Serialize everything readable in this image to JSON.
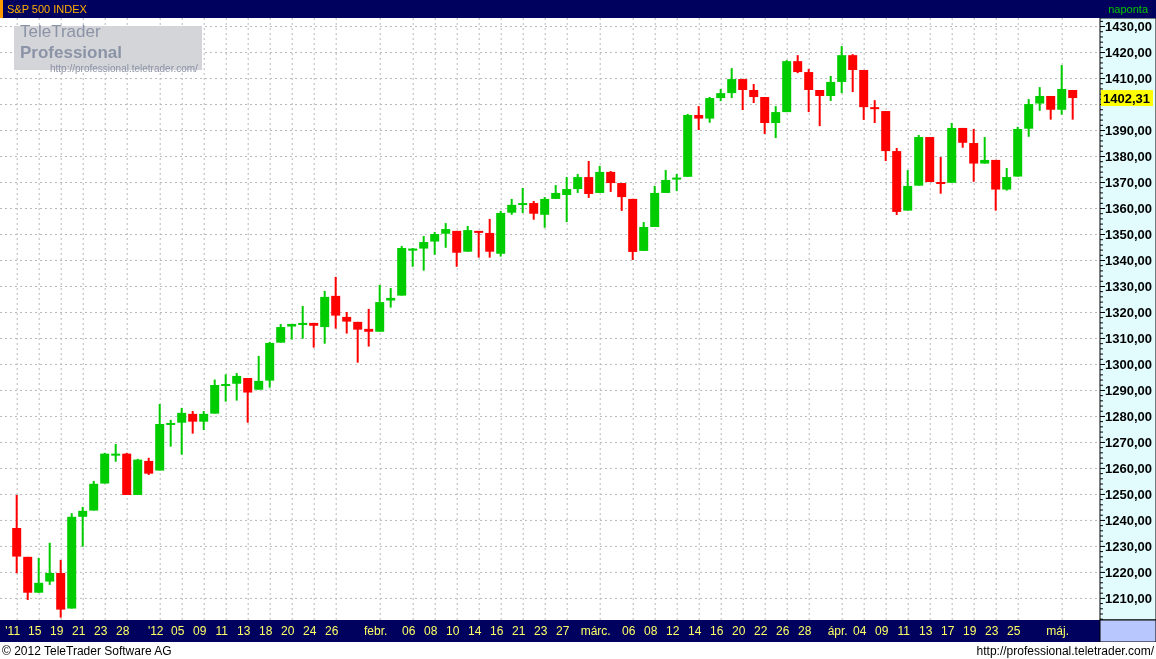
{
  "header": {
    "title": "S&P 500 INDEX",
    "interval": "naponta"
  },
  "logo": {
    "name": "TeleTrader **Professional**",
    "url": "http://professional.teletrader.com/"
  },
  "chart": {
    "current_price": "1402,31",
    "chart_data": {
      "type": "candlestick",
      "grid": true,
      "ylim": [
        1201.5,
        1433.1
      ],
      "categories": [
        "'11",
        null,
        "15",
        null,
        "19",
        null,
        "21",
        null,
        "23",
        null,
        "28",
        null,
        null,
        "'12",
        null,
        "05",
        null,
        "09",
        null,
        "11",
        null,
        "13",
        null,
        "18",
        null,
        "20",
        null,
        "24",
        null,
        "26",
        null,
        null,
        null,
        "febr.",
        null,
        null,
        "06",
        null,
        "08",
        null,
        "10",
        null,
        "14",
        null,
        "16",
        null,
        "21",
        null,
        "23",
        null,
        "27",
        null,
        null,
        "márc.",
        null,
        null,
        "06",
        null,
        "08",
        null,
        "12",
        null,
        "14",
        null,
        "16",
        null,
        "20",
        null,
        "22",
        null,
        "26",
        null,
        "28",
        null,
        null,
        "ápr.",
        null,
        "04",
        null,
        "09",
        null,
        "11",
        null,
        "13",
        null,
        "17",
        null,
        "19",
        null,
        "23",
        null,
        "25",
        null,
        null,
        null,
        "máj.",
        null
      ],
      "ohlc": [
        [
          1236.9,
          1249.6,
          1219.5,
          1225.9
        ],
        [
          1225.8,
          1225.8,
          1209.2,
          1212.0
        ],
        [
          1212.0,
          1225.4,
          1212.0,
          1215.8
        ],
        [
          1216.3,
          1231.2,
          1215.0,
          1219.6
        ],
        [
          1219.6,
          1224.6,
          1202.4,
          1205.5
        ],
        [
          1205.9,
          1242.6,
          1205.9,
          1241.2
        ],
        [
          1241.2,
          1245.0,
          1229.7,
          1243.5
        ],
        [
          1243.6,
          1255.0,
          1243.6,
          1253.9
        ],
        [
          1254.0,
          1265.8,
          1254.0,
          1265.5
        ],
        [
          1264.8,
          1269.2,
          1262.4,
          1265.5
        ],
        [
          1265.5,
          1265.8,
          1249.6,
          1249.6
        ],
        [
          1249.6,
          1263.5,
          1249.6,
          1263.2
        ],
        [
          1262.7,
          1263.9,
          1257.3,
          1257.8
        ],
        [
          1259.0,
          1284.6,
          1259.0,
          1276.9
        ],
        [
          1276.6,
          1278.5,
          1268.2,
          1277.3
        ],
        [
          1277.4,
          1283.1,
          1265.1,
          1281.2
        ],
        [
          1280.8,
          1281.9,
          1273.2,
          1277.8
        ],
        [
          1277.8,
          1281.9,
          1274.6,
          1280.8
        ],
        [
          1280.9,
          1294.0,
          1280.9,
          1291.9
        ],
        [
          1291.7,
          1296.0,
          1285.5,
          1292.3
        ],
        [
          1292.4,
          1296.5,
          1285.9,
          1295.4
        ],
        [
          1294.6,
          1294.6,
          1277.4,
          1289.0
        ],
        [
          1290.1,
          1303.1,
          1290.1,
          1293.5
        ],
        [
          1293.6,
          1308.5,
          1290.9,
          1308.1
        ],
        [
          1308.2,
          1315.4,
          1308.2,
          1314.2
        ],
        [
          1314.4,
          1315.4,
          1309.4,
          1315.4
        ],
        [
          1315.0,
          1322.3,
          1309.7,
          1315.8
        ],
        [
          1315.8,
          1315.8,
          1306.3,
          1314.7
        ],
        [
          1314.2,
          1328.1,
          1307.8,
          1325.8
        ],
        [
          1326.2,
          1333.5,
          1313.6,
          1318.6
        ],
        [
          1318.1,
          1320.0,
          1311.7,
          1316.3
        ],
        [
          1316.2,
          1316.2,
          1300.5,
          1313.2
        ],
        [
          1313.5,
          1321.2,
          1306.7,
          1312.4
        ],
        [
          1312.4,
          1330.4,
          1312.4,
          1323.8
        ],
        [
          1324.4,
          1329.2,
          1321.7,
          1325.4
        ],
        [
          1326.3,
          1345.4,
          1326.3,
          1344.6
        ],
        [
          1343.6,
          1344.6,
          1337.4,
          1344.4
        ],
        [
          1344.4,
          1349.2,
          1335.9,
          1346.9
        ],
        [
          1347.1,
          1350.8,
          1342.0,
          1350.0
        ],
        [
          1350.1,
          1354.2,
          1344.7,
          1351.9
        ],
        [
          1351.2,
          1351.2,
          1337.4,
          1342.8
        ],
        [
          1343.2,
          1353.1,
          1343.2,
          1351.5
        ],
        [
          1351.2,
          1351.2,
          1340.9,
          1350.5
        ],
        [
          1350.4,
          1355.8,
          1340.9,
          1343.2
        ],
        [
          1342.4,
          1358.9,
          1341.3,
          1358.1
        ],
        [
          1358.2,
          1363.5,
          1357.4,
          1361.2
        ],
        [
          1361.2,
          1367.7,
          1358.1,
          1361.9
        ],
        [
          1361.9,
          1362.7,
          1355.5,
          1357.8
        ],
        [
          1357.4,
          1364.2,
          1352.4,
          1363.5
        ],
        [
          1363.5,
          1368.8,
          1363.5,
          1365.8
        ],
        [
          1365.0,
          1371.9,
          1354.6,
          1367.3
        ],
        [
          1367.3,
          1373.1,
          1365.8,
          1371.9
        ],
        [
          1371.9,
          1378.1,
          1363.9,
          1365.4
        ],
        [
          1365.8,
          1376.2,
          1365.8,
          1373.9
        ],
        [
          1373.9,
          1374.2,
          1366.2,
          1369.6
        ],
        [
          1369.6,
          1369.6,
          1358.9,
          1364.2
        ],
        [
          1363.5,
          1363.5,
          1340.0,
          1343.1
        ],
        [
          1343.5,
          1354.6,
          1343.5,
          1352.7
        ],
        [
          1352.7,
          1368.5,
          1352.7,
          1365.8
        ],
        [
          1365.8,
          1374.6,
          1365.8,
          1370.8
        ],
        [
          1371.2,
          1373.1,
          1366.5,
          1371.7
        ],
        [
          1372.0,
          1396.2,
          1372.0,
          1395.8
        ],
        [
          1395.8,
          1399.2,
          1390.0,
          1394.4
        ],
        [
          1394.4,
          1402.7,
          1392.8,
          1402.3
        ],
        [
          1402.3,
          1405.8,
          1401.1,
          1404.2
        ],
        [
          1404.2,
          1413.8,
          1402.3,
          1409.6
        ],
        [
          1409.6,
          1409.6,
          1397.7,
          1405.4
        ],
        [
          1405.4,
          1407.7,
          1400.4,
          1402.7
        ],
        [
          1402.7,
          1402.7,
          1388.5,
          1392.7
        ],
        [
          1392.7,
          1399.2,
          1386.9,
          1396.9
        ],
        [
          1396.9,
          1416.9,
          1396.9,
          1416.5
        ],
        [
          1416.5,
          1418.8,
          1411.9,
          1412.3
        ],
        [
          1412.3,
          1413.5,
          1396.9,
          1405.4
        ],
        [
          1405.4,
          1405.4,
          1391.5,
          1403.1
        ],
        [
          1403.1,
          1410.8,
          1401.2,
          1408.5
        ],
        [
          1408.5,
          1422.3,
          1404.2,
          1418.8
        ],
        [
          1418.8,
          1419.2,
          1404.6,
          1413.1
        ],
        [
          1413.1,
          1413.1,
          1393.9,
          1398.8
        ],
        [
          1398.8,
          1401.5,
          1392.7,
          1398.1
        ],
        [
          1397.3,
          1397.3,
          1378.1,
          1381.9
        ],
        [
          1381.9,
          1383.1,
          1357.3,
          1358.5
        ],
        [
          1359.0,
          1374.6,
          1359.0,
          1368.5
        ],
        [
          1368.6,
          1388.1,
          1368.6,
          1387.3
        ],
        [
          1387.3,
          1387.3,
          1370.0,
          1370.0
        ],
        [
          1370.0,
          1379.6,
          1365.5,
          1369.4
        ],
        [
          1369.7,
          1392.7,
          1369.7,
          1390.8
        ],
        [
          1390.8,
          1390.8,
          1383.2,
          1385.1
        ],
        [
          1385.0,
          1390.4,
          1370.1,
          1377.1
        ],
        [
          1377.1,
          1387.3,
          1377.1,
          1378.5
        ],
        [
          1378.5,
          1378.5,
          1359.0,
          1367.1
        ],
        [
          1367.1,
          1375.4,
          1366.7,
          1371.9
        ],
        [
          1372.1,
          1391.2,
          1372.1,
          1390.4
        ],
        [
          1390.5,
          1401.9,
          1387.4,
          1400.0
        ],
        [
          1400.2,
          1406.5,
          1397.4,
          1403.1
        ],
        [
          1403.1,
          1403.1,
          1394.0,
          1397.8
        ],
        [
          1397.8,
          1415.0,
          1395.9,
          1405.8
        ],
        [
          1405.4,
          1405.4,
          1394.0,
          1402.3
        ]
      ],
      "yticks": [
        {
          "value": 1430,
          "label": "1430,00"
        },
        {
          "value": 1420,
          "label": "1420,00"
        },
        {
          "value": 1410,
          "label": "1410,00"
        },
        {
          "value": 1390,
          "label": "1390,00"
        },
        {
          "value": 1380,
          "label": "1380,00"
        },
        {
          "value": 1370,
          "label": "1370,00"
        },
        {
          "value": 1360,
          "label": "1360,00"
        },
        {
          "value": 1350,
          "label": "1350,00"
        },
        {
          "value": 1340,
          "label": "1340,00"
        },
        {
          "value": 1330,
          "label": "1330,00"
        },
        {
          "value": 1320,
          "label": "1320,00"
        },
        {
          "value": 1310,
          "label": "1310,00"
        },
        {
          "value": 1300,
          "label": "1300,00"
        },
        {
          "value": 1290,
          "label": "1290,00"
        },
        {
          "value": 1280,
          "label": "1280,00"
        },
        {
          "value": 1270,
          "label": "1270,00"
        },
        {
          "value": 1260,
          "label": "1260,00"
        },
        {
          "value": 1250,
          "label": "1250,00"
        },
        {
          "value": 1240,
          "label": "1240,00"
        },
        {
          "value": 1230,
          "label": "1230,00"
        },
        {
          "value": 1220,
          "label": "1220,00"
        },
        {
          "value": 1210,
          "label": "1210,00"
        }
      ]
    }
  },
  "footer": {
    "copyright": "© 2012 TeleTrader Software AG",
    "url": "http://professional.teletrader.com/"
  }
}
